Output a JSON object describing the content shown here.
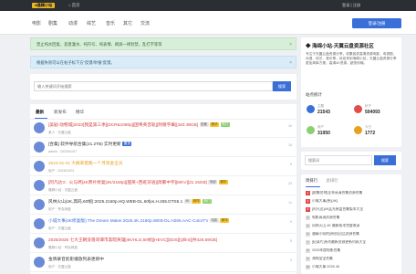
{
  "topbar": {
    "logo": "●骚精小站",
    "home": "⌂ 首页",
    "right": "登录 | 注册"
  },
  "nav": {
    "items": [
      "电影",
      "剧集",
      "动漫",
      "综艺",
      "音乐",
      "其它",
      "交流"
    ],
    "login_label": "登录/注册"
  },
  "alerts": [
    {
      "text": "禁止纯水回复，恶意灌水、纯符号、纯表情、刷屏一律封禁，乱打字等等",
      "color": "#d7efd9"
    },
    {
      "text": "根据失效可以在帖子标下方“反馈/举报”反馈。",
      "color": "#d9ecf7"
    }
  ],
  "search": {
    "placeholder": "输入关键词开始搜索",
    "button": "搜索"
  },
  "tabs": [
    "最新",
    "新发布",
    "精华"
  ],
  "posts": [
    {
      "title": "[美剧·动物城]2023[我是第三季][DCR&1080p][国粤英音轨][附赠字幕][183.38GB]",
      "meta": "某人 · 天翼云盘",
      "badges": [
        [
          "剧集",
          "grey"
        ],
        [
          "精华",
          "yellow"
        ],
        [
          "热门",
          "green"
        ]
      ],
      "count": "30",
      "title_color": "#d63a3a"
    },
    {
      "title": "[合集] 软件导航合集(21.2TB) 实时更新",
      "meta": "admin · 2023/01/07",
      "badges": [
        [
          "置顶",
          "blue"
        ]
      ],
      "count": "18",
      "title_color": "#333"
    },
    {
      "title": "2024-01-01 大概率套路一个月资金全员",
      "meta": "用户 · 2024/01/01",
      "badges": [],
      "count": "6",
      "title_color": "#e8a021"
    },
    {
      "title": "[阿凡达3：火与烬]4K原片修复[4K/2160p][国英+西班牙语][简繁中字][MKV][21.15GB]",
      "meta": "骚精小站 · 天翼云盘",
      "badges": [
        [
          "电影",
          "grey"
        ],
        [
          "精华",
          "yellow"
        ]
      ],
      "count": "23",
      "title_color": "#d63a3a"
    },
    {
      "title": "风林火山(4K,高码,60帧):2025.2160p.HQ.WEB-DL.60fps.H.265.DTS5.1",
      "meta": "用户 · 夸克网盘",
      "badges": [
        [
          "4K",
          "grey"
        ],
        [
          "精华",
          "yellow"
        ],
        [
          "热门",
          "green"
        ]
      ],
      "count": "11",
      "title_color": "#333"
    },
    {
      "title": "小城大事(4K修复版):The Dream Maker.2026.4K.2160p.WEB-DL.H265.AAC-ColorTV",
      "meta": "用户 · 天翼云盘",
      "badges": [
        [
          "电影",
          "grey"
        ],
        [
          "精华",
          "yellow"
        ]
      ],
      "count": "9",
      "title_color": "#3b6fd8"
    },
    {
      "title": "2025/2026 七大王朝没落哥谭市黑暗英雄[4K/HLG,60帧][HEVC][DDS][Qfilm][共425.69GB]",
      "meta": "骚精小站 · 夸克网盘",
      "badges": [],
      "count": "5",
      "title_color": "#d63a3a"
    },
    {
      "title": "金牌录音剪影播放列表更新中",
      "meta": "用户 · 天翼云盘",
      "badges": [],
      "count": "3",
      "title_color": "#333"
    }
  ],
  "sidebar": {
    "title": "◆ 海绵小站-天翼云盘资源社区",
    "desc": "专注于天翼云盘资源分享，收集各类高清资源电影、电视剧、动漫、综艺、音乐等，欢迎来到海绵小站，天翼云盘资源分享更加简单方便，高清4K资源，超快传输。",
    "stats_title": "站点统计",
    "stats": [
      {
        "label": "主题",
        "value": "21543",
        "color": "#3b6fd8"
      },
      {
        "label": "帖子",
        "value": "504093",
        "color": "#e34c4c"
      },
      {
        "label": "用户",
        "value": "31950",
        "color": "#8bcf6e"
      },
      {
        "label": "今日",
        "value": "1772",
        "color": "#e8a021"
      }
    ],
    "search_placeholder": "搜索词",
    "search_button": "搜索",
    "rank_tabs": [
      "周排行",
      "总排行"
    ],
    "rank": [
      "[剧集名称]全季高清合集资源合集",
      "小城大事(原)[4K]",
      "[阿凡达]4K蓝光原盘合集版本大全",
      "电影高清资源合集",
      "风林火山 4K 最新版本完整收录",
      "骚精小站的(原创)出品资源合集",
      "[纪录片]系列最新资源更新列表大全",
      "2025年度电影合集",
      "海绵宝宝合集",
      "小城大事 2026 4K"
    ]
  }
}
